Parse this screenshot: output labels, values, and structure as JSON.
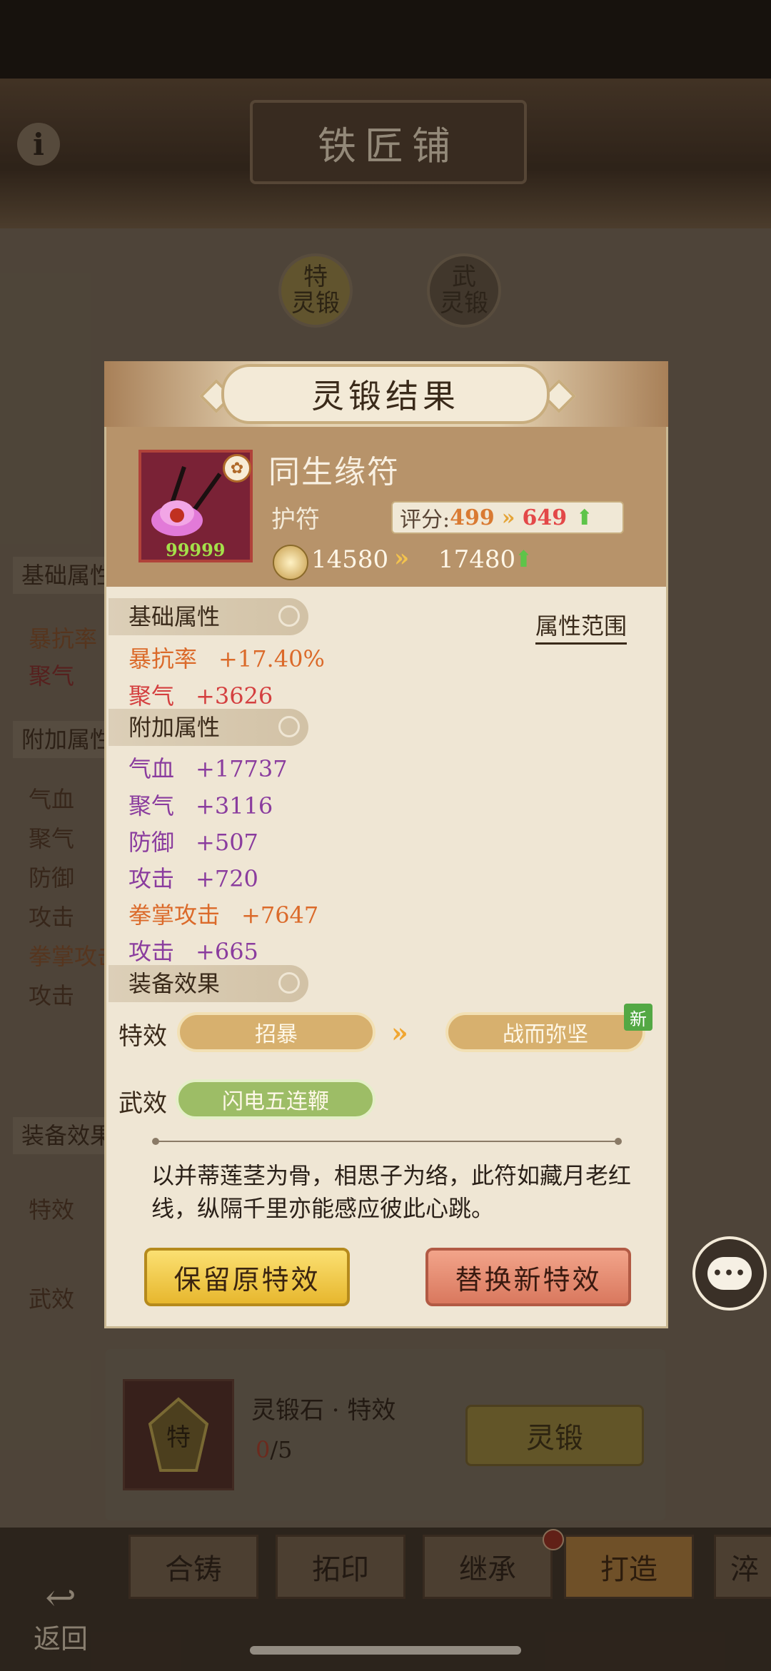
{
  "header": {
    "title": "铁匠铺"
  },
  "forge_tabs": [
    {
      "badge": "特",
      "label": "灵锻"
    },
    {
      "badge": "武",
      "label": "灵锻"
    }
  ],
  "background_panel": {
    "basic_section": "基础属性",
    "basic_items": [
      "暴抗率",
      "聚气"
    ],
    "extra_section": "附加属性",
    "extra_items": [
      "气血",
      "聚气",
      "防御",
      "攻击",
      "拳掌攻击",
      "攻击"
    ],
    "effect_section": "装备效果",
    "effect_items": [
      "特效",
      "武效"
    ]
  },
  "material": {
    "name": "灵锻石 · 特效",
    "count_current": "0",
    "count_total": "/5",
    "button": "灵锻"
  },
  "nav": {
    "cast": "合铸",
    "rub": "拓印",
    "inherit": "继承",
    "forge": "打造",
    "more": "淬",
    "back": "返回"
  },
  "dialog": {
    "title": "灵锻结果",
    "item": {
      "name": "同生缘符",
      "type": "护符",
      "level_text": "99999",
      "score_label": "评分:",
      "score_old": "499",
      "score_new": "649",
      "power_old": "14580",
      "power_new": "17480"
    },
    "range_link": "属性范围",
    "basic_section": "基础属性",
    "basic_attrs": [
      {
        "name": "暴抗率",
        "value": "+17.40%",
        "color": "#db6a2a"
      },
      {
        "name": "聚气",
        "value": "+3626",
        "color": "#d43f3f"
      }
    ],
    "extra_section": "附加属性",
    "extra_attrs": [
      {
        "name": "气血",
        "value": "+17737",
        "color": "#8a3c9e"
      },
      {
        "name": "聚气",
        "value": "+3116",
        "color": "#8a3c9e"
      },
      {
        "name": "防御",
        "value": "+507",
        "color": "#8a3c9e"
      },
      {
        "name": "攻击",
        "value": "+720",
        "color": "#8a3c9e"
      },
      {
        "name": "拳掌攻击",
        "value": "+7647",
        "color": "#db6a2a"
      },
      {
        "name": "攻击",
        "value": "+665",
        "color": "#8a3c9e"
      }
    ],
    "effect_section": "装备效果",
    "special_label": "特效",
    "special_old": "招暴",
    "special_new": "战而弥坚",
    "new_badge": "新",
    "weapon_label": "武效",
    "weapon_effect": "闪电五连鞭",
    "lore": "以并蒂莲茎为骨，相思子为络，此符如藏月老红线，纵隔千里亦能感应彼此心跳。",
    "keep_button": "保留原特效",
    "replace_button": "替换新特效"
  },
  "chat": {
    "icon": "chat-bubble-icon",
    "glyph": "•••"
  },
  "colors": {
    "accent_gold": "#e7b72e",
    "replace_red": "#d9785e",
    "up_green": "#5ec449",
    "new_badge": "#53a844"
  }
}
